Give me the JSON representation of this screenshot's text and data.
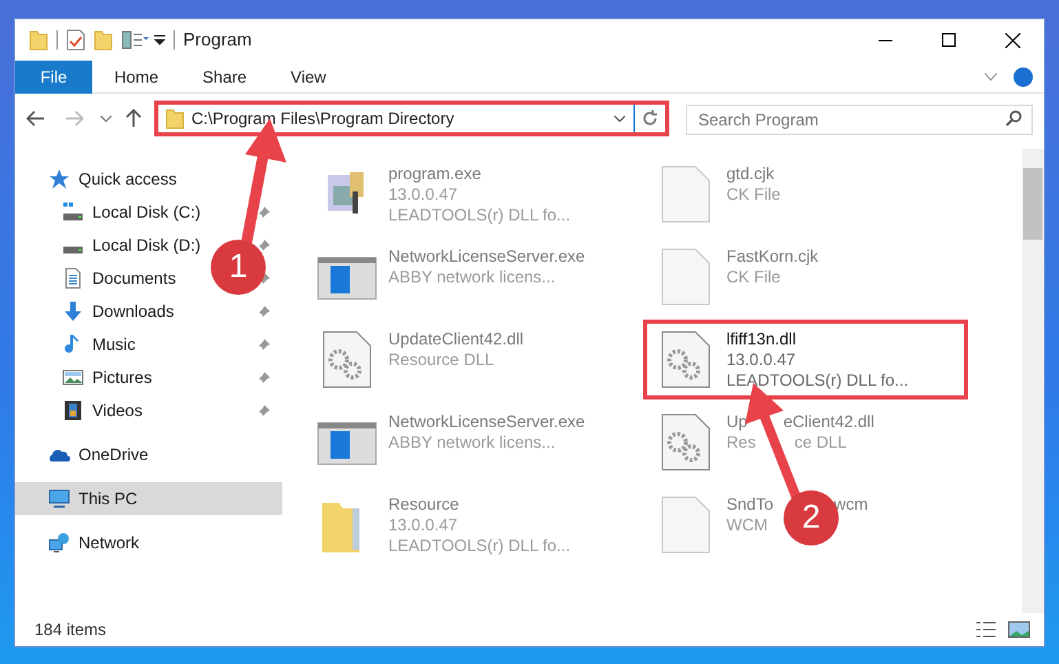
{
  "window": {
    "title": "Program"
  },
  "ribbon_tabs": [
    {
      "label": "File",
      "selected": true
    },
    {
      "label": "Home",
      "selected": false
    },
    {
      "label": "Share",
      "selected": false
    },
    {
      "label": "View",
      "selected": false
    }
  ],
  "address_bar": {
    "value": "C:\\Program Files\\Program Directory",
    "highlighted": true
  },
  "search": {
    "placeholder": "Search Program"
  },
  "sidebar": {
    "items": [
      {
        "label": "Quick access",
        "kind": "star",
        "selected": false,
        "children": [
          {
            "label": "Local Disk (C:)",
            "kind": "disk_c",
            "pinned": true,
            "selected": false
          },
          {
            "label": "Local Disk (D:)",
            "kind": "disk",
            "pinned": true,
            "selected": false
          },
          {
            "label": "Documents",
            "kind": "documents",
            "pinned": true,
            "selected": false
          },
          {
            "label": "Downloads",
            "kind": "downloads",
            "pinned": true,
            "selected": false
          },
          {
            "label": "Music",
            "kind": "music",
            "pinned": true,
            "selected": false
          },
          {
            "label": "Pictures",
            "kind": "pictures",
            "pinned": true,
            "selected": false
          },
          {
            "label": "Videos",
            "kind": "videos",
            "pinned": true,
            "selected": false
          }
        ]
      },
      {
        "label": "OneDrive",
        "kind": "cloud",
        "selected": false
      },
      {
        "label": "This PC",
        "kind": "pc",
        "selected": true
      },
      {
        "label": "Network",
        "kind": "network",
        "selected": false
      }
    ]
  },
  "files": [
    {
      "name": [
        "program.exe"
      ],
      "lines": [
        [
          "13.0.0.47"
        ],
        [
          "LEADTOOLS(r) DLL fo..."
        ]
      ],
      "kind": "exe",
      "highlighted": false
    },
    {
      "name": [
        "gtd.cjk"
      ],
      "lines": [
        [
          "CK File"
        ]
      ],
      "kind": "blank",
      "highlighted": false
    },
    {
      "name": [
        "NetworkLicenseServer.exe"
      ],
      "lines": [
        [
          "ABBY network licens..."
        ]
      ],
      "kind": "app",
      "highlighted": false
    },
    {
      "name": [
        "FastKorn.cjk"
      ],
      "lines": [
        [
          "CK File"
        ]
      ],
      "kind": "blank",
      "highlighted": false
    },
    {
      "name": [
        "UpdateClient42.dll"
      ],
      "lines": [
        [
          "Resource DLL"
        ]
      ],
      "kind": "dll",
      "highlighted": false
    },
    {
      "name": [
        "lfiff13n.dll"
      ],
      "lines": [
        [
          "13.0.0.47"
        ],
        [
          "LEADTOOLS(r) DLL fo..."
        ]
      ],
      "kind": "dll",
      "highlighted": true
    },
    {
      "name": [
        "NetworkLicenseServer.exe"
      ],
      "lines": [
        [
          "ABBY network licens..."
        ]
      ],
      "kind": "app",
      "highlighted": false
    },
    {
      "name": [
        "Up",
        "eClient42.dll"
      ],
      "lines": [
        [
          "Res",
          "ce DLL"
        ]
      ],
      "kind": "dll",
      "highlighted": false
    },
    {
      "name": [
        "Resource"
      ],
      "lines": [
        [
          "13.0.0.47"
        ],
        [
          "LEADTOOLS(r) DLL fo..."
        ]
      ],
      "kind": "folder",
      "highlighted": false
    },
    {
      "name": [
        "SndTo",
        "wcm"
      ],
      "lines": [
        [
          "WCM"
        ]
      ],
      "kind": "blank",
      "highlighted": false
    }
  ],
  "status_bar": {
    "item_count": "184 items"
  },
  "annotations": [
    {
      "label": "1"
    },
    {
      "label": "2"
    }
  ]
}
